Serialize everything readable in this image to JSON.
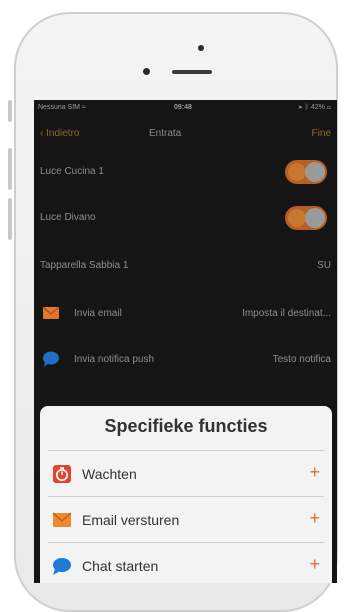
{
  "status_bar": {
    "carrier": "Nessuna SIM",
    "wifi_glyph": "≈",
    "time": "09:48",
    "battery": "42%"
  },
  "nav": {
    "back_label": "Indietro",
    "title": "Entrata",
    "done_label": "Fine"
  },
  "list": {
    "items": [
      {
        "label": "Luce Cucina 1",
        "toggle_on": true
      },
      {
        "label": "Luce Divano",
        "toggle_on": true
      },
      {
        "label": "Tapparella Sabbia 1",
        "value": "SU"
      },
      {
        "label": "Invia email",
        "value": "Imposta il destinat...",
        "icon": "email-icon"
      },
      {
        "label": "Invia notifica push",
        "value": "Testo notifica",
        "icon": "chat-bubble-icon"
      }
    ]
  },
  "sheet": {
    "title": "Specifieke functies",
    "items": [
      {
        "label": "Wachten",
        "icon": "timer-icon",
        "action": "+"
      },
      {
        "label": "Email versturen",
        "icon": "email-icon",
        "action": "+"
      },
      {
        "label": "Chat starten",
        "icon": "chat-bubble-icon",
        "action": "+"
      }
    ]
  },
  "colors": {
    "accent": "#e16b35",
    "toggle_track": "#b85f23",
    "screen_bg": "#151515",
    "chat_blue": "#1e7ad9"
  }
}
